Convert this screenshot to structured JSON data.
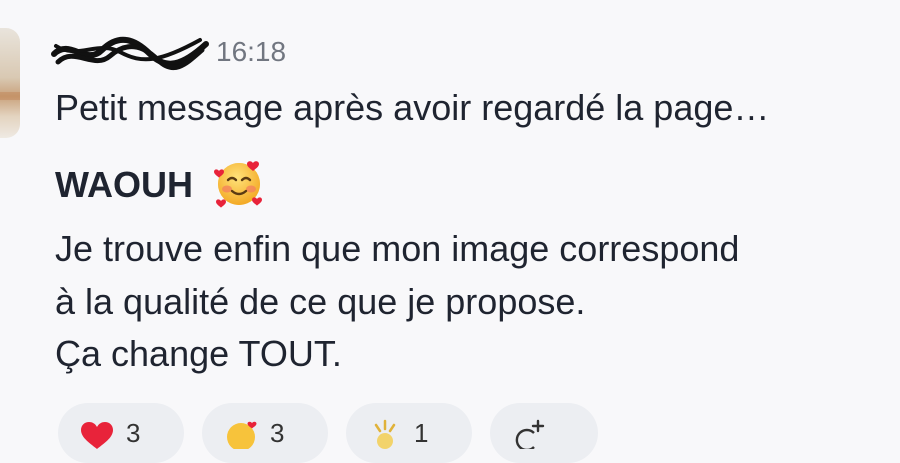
{
  "message": {
    "time": "16:18",
    "line1": "Petit message après avoir regardé la page…",
    "heading": "WAOUH",
    "heading_emoji": "smiling-face-with-hearts-icon",
    "line3": "Je trouve enfin que mon image correspond",
    "line4": "à la qualité de ce que je propose.",
    "line5": "Ça change TOUT."
  },
  "reactions": [
    {
      "icon": "red-heart-icon",
      "count": "3"
    },
    {
      "icon": "smiling-face-with-hearts-icon",
      "count": "3"
    },
    {
      "icon": "sparkle-icon",
      "count": "1"
    },
    {
      "icon": "add-reaction-icon",
      "count": ""
    }
  ],
  "colors": {
    "background": "#f8f8fa",
    "text": "#1f2430",
    "time": "#717680",
    "pill": "#eceef2"
  }
}
